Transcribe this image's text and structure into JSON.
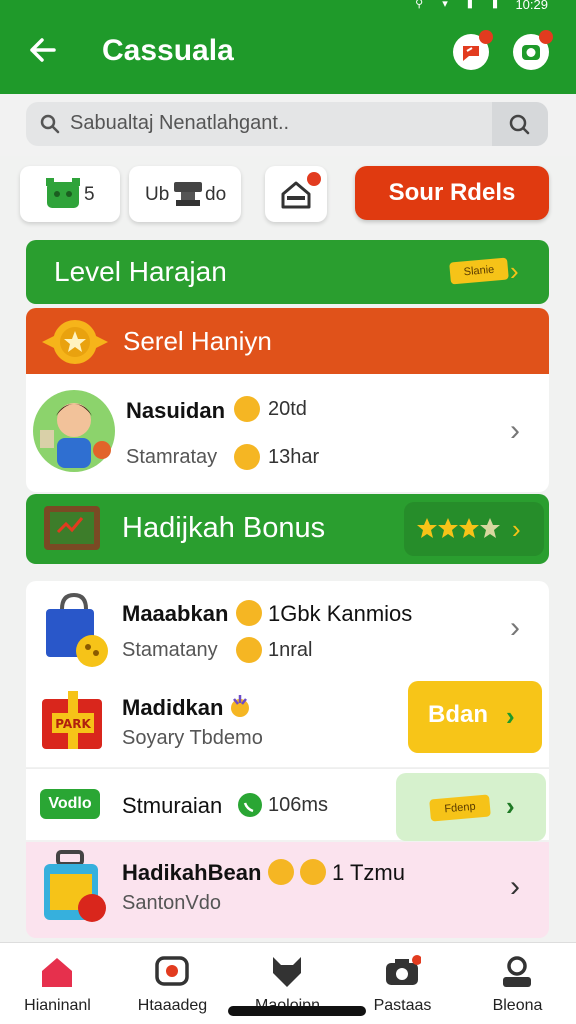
{
  "status": {
    "time": "10:29"
  },
  "header": {
    "title": "Cassuala"
  },
  "search": {
    "placeholder": "Sabualtaj Nenatlahgant.."
  },
  "chips": [
    {
      "label": "5"
    },
    {
      "label_left": "Ub",
      "label_right": "do"
    },
    {
      "label": ""
    }
  ],
  "cta": {
    "label": "Sour Rdels"
  },
  "level_banner": {
    "title": "Level Harajan",
    "tag": "Slanie"
  },
  "seasonal_banner": {
    "title": "Serel Haniyn"
  },
  "profile_row": {
    "name": "Nasuidan",
    "count": "20td",
    "sub": "Stamratay",
    "sub_count": "13har"
  },
  "bonus_banner": {
    "title": "Hadijkah Bonus"
  },
  "rows": [
    {
      "title": "Maaabkan",
      "title_suffix": "1Gbk Kanmios",
      "sub": "Stamatany",
      "sub_suffix": "1nral"
    },
    {
      "title": "Madidkan",
      "sub": "Soyary Tbdemo",
      "button": "Bdan"
    },
    {
      "badge": "Vodlo",
      "title": "Stmuraian",
      "suffix": "106ms",
      "tag": "Fdenp"
    },
    {
      "title": "HadikahBean",
      "title_suffix": "1 Tzmu",
      "sub": "SantonVdo",
      "crate_label": "PARK"
    }
  ],
  "nav": [
    {
      "label": "Hianinanl",
      "icon": "home-icon",
      "color": "#e6304d"
    },
    {
      "label": "Htaaadeg",
      "icon": "chat-icon"
    },
    {
      "label": "Maoloipn",
      "icon": "wolf-icon"
    },
    {
      "label": "Pastaas",
      "icon": "camera-icon"
    },
    {
      "label": "Bleona",
      "icon": "profile-icon"
    }
  ],
  "colors": {
    "primary_green": "#1f9a2a",
    "accent_orange": "#e0521a",
    "cta_red": "#e03a10",
    "gold": "#f7c518"
  }
}
